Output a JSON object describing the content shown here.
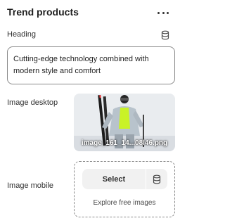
{
  "panel": {
    "title": "Trend products",
    "more_icon": "more-horizontal-icon"
  },
  "heading_field": {
    "label": "Heading",
    "source_icon": "database-icon",
    "value": "Cutting-edge technology combined with modern style and comfort"
  },
  "image_desktop": {
    "label": "Image desktop",
    "filename": "image_161_14...08l46.png"
  },
  "image_mobile": {
    "label": "Image mobile",
    "select_label": "Select",
    "source_icon": "database-icon",
    "explore_label": "Explore free images"
  },
  "colors": {
    "text": "#303030",
    "border": "#8a8a8a",
    "button_bg": "#f1f1f1",
    "jacket_accent": "#c9f227"
  }
}
